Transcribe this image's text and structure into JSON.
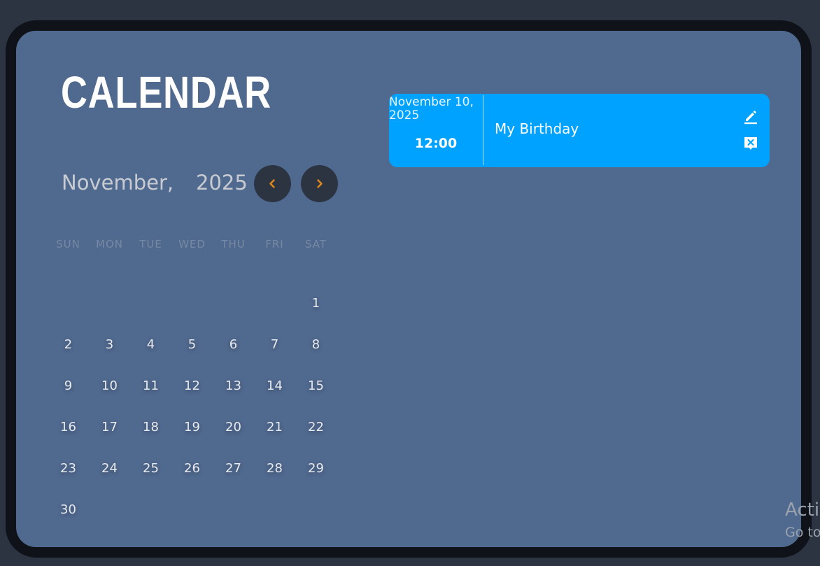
{
  "app": {
    "title": "CALENDAR"
  },
  "navigation": {
    "month": "November,",
    "year": "2025",
    "prev_icon": "chevron-left-icon",
    "next_icon": "chevron-right-icon",
    "arrow_color": "#e08a1e"
  },
  "weekdays": [
    "SUN",
    "MON",
    "TUE",
    "WED",
    "THU",
    "FRI",
    "SAT"
  ],
  "calendar": {
    "first_weekday_index": 6,
    "days": [
      "1",
      "2",
      "3",
      "4",
      "5",
      "6",
      "7",
      "8",
      "9",
      "10",
      "11",
      "12",
      "13",
      "14",
      "15",
      "16",
      "17",
      "18",
      "19",
      "20",
      "21",
      "22",
      "23",
      "24",
      "25",
      "26",
      "27",
      "28",
      "29",
      "30"
    ]
  },
  "events": [
    {
      "date": "November 10, 2025",
      "time": "12:00",
      "title": "My Birthday",
      "edit_icon": "pencil-icon",
      "delete_icon": "delete-comment-icon"
    }
  ],
  "colors": {
    "panel": "#50698e",
    "event_card": "#00a2ff",
    "nav_button": "#2b3440"
  },
  "watermark": {
    "line1": "Acti",
    "line2": "Go to"
  }
}
